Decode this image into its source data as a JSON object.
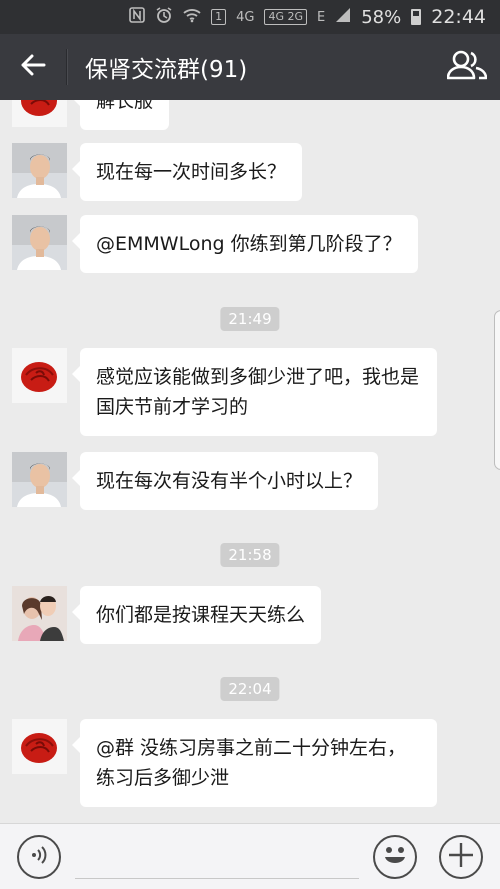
{
  "status_bar": {
    "icons": [
      "nfc-icon",
      "alarm-icon",
      "wifi-icon",
      "notification-1-icon",
      "4g-icon",
      "4g-2g-icon",
      "e-icon",
      "signal-icon",
      "battery-icon"
    ],
    "badge_1": "1",
    "net_4g": "4G",
    "net_4g2g": "4G 2G",
    "net_e": "E",
    "battery_percent": "58%",
    "time": "22:44"
  },
  "app_bar": {
    "back_icon": "arrow-left-icon",
    "title": "保肾交流群(91)",
    "members_icon": "group-members-icon"
  },
  "messages": [
    {
      "avatar": "rose-avatar",
      "text": "解长服",
      "partial": true
    },
    {
      "avatar": "young-man-avatar",
      "text": "现在每一次时间多长？"
    },
    {
      "avatar": "young-man-avatar",
      "text": "@EMMWLong 你练到第几阶段了？"
    },
    {
      "time": "21:49"
    },
    {
      "avatar": "rose-avatar",
      "text": "感觉应该能做到多御少泄了吧，我也是国庆节前才学习的"
    },
    {
      "avatar": "young-man-avatar",
      "text": "现在每次有没有半个小时以上？"
    },
    {
      "time": "21:58"
    },
    {
      "avatar": "couple-avatar",
      "text": "你们都是按课程天天练么"
    },
    {
      "time": "22:04"
    },
    {
      "avatar": "rose-avatar",
      "text": "@群 没练习房事之前二十分钟左右，练习后多御少泄"
    }
  ],
  "input_bar": {
    "voice_icon": "voice-icon",
    "input_placeholder": "",
    "emoji_icon": "emoji-icon",
    "plus_icon": "plus-icon"
  }
}
